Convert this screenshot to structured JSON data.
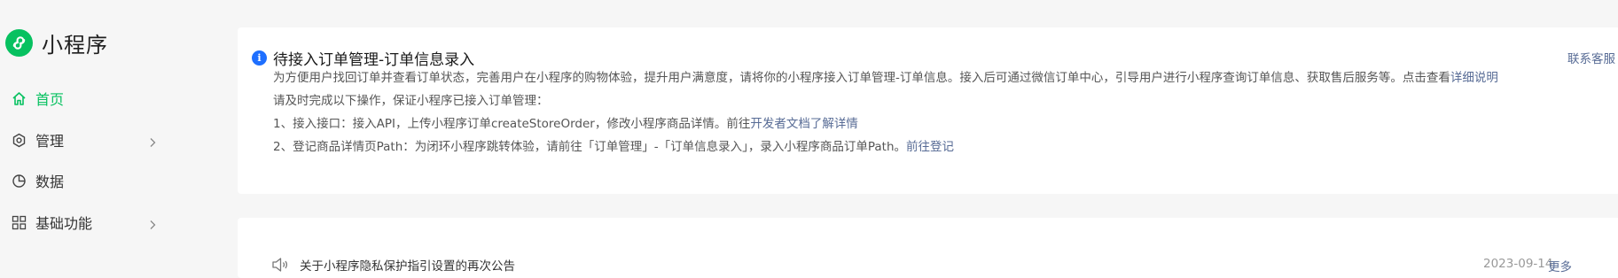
{
  "brand": {
    "name": "小程序",
    "logo_icon": "mini-program-logo-icon",
    "color": "#07c160"
  },
  "sidebar": {
    "items": [
      {
        "label": "首页",
        "icon": "home-icon",
        "active": true,
        "expandable": false
      },
      {
        "label": "管理",
        "icon": "manage-icon",
        "active": false,
        "expandable": true
      },
      {
        "label": "数据",
        "icon": "data-icon",
        "active": false,
        "expandable": false
      },
      {
        "label": "基础功能",
        "icon": "grid-icon",
        "active": false,
        "expandable": true
      }
    ]
  },
  "notice": {
    "title": "待接入订单管理-订单信息录入",
    "contact_link": "联系客服",
    "description": "为方便用户找回订单并查看订单状态，完善用户在小程序的购物体验，提升用户满意度，请将你的小程序接入订单管理-订单信息。接入后可通过微信订单中心，引导用户进行小程序查询订单信息、获取售后服务等。点击查看",
    "description_link": "详细说明",
    "prompt": "请及时完成以下操作，保证小程序已接入订单管理：",
    "step1_text": "1、接入接口：接入API，上传小程序订单createStoreOrder，修改小程序商品详情。前往",
    "step1_link": "开发者文档了解详情",
    "step2_text": "2、登记商品详情页Path：为闭环小程序跳转体验，请前往「订单管理」-「订单信息录入」，录入小程序商品订单Path。",
    "step2_link": "前往登记"
  },
  "announcement": {
    "icon": "speaker-icon",
    "title": "关于小程序隐私保护指引设置的再次公告",
    "date": "2023-09-14",
    "more_label": "更多"
  },
  "colors": {
    "accent": "#07c160",
    "link": "#576b95",
    "info": "#1e6fff"
  }
}
